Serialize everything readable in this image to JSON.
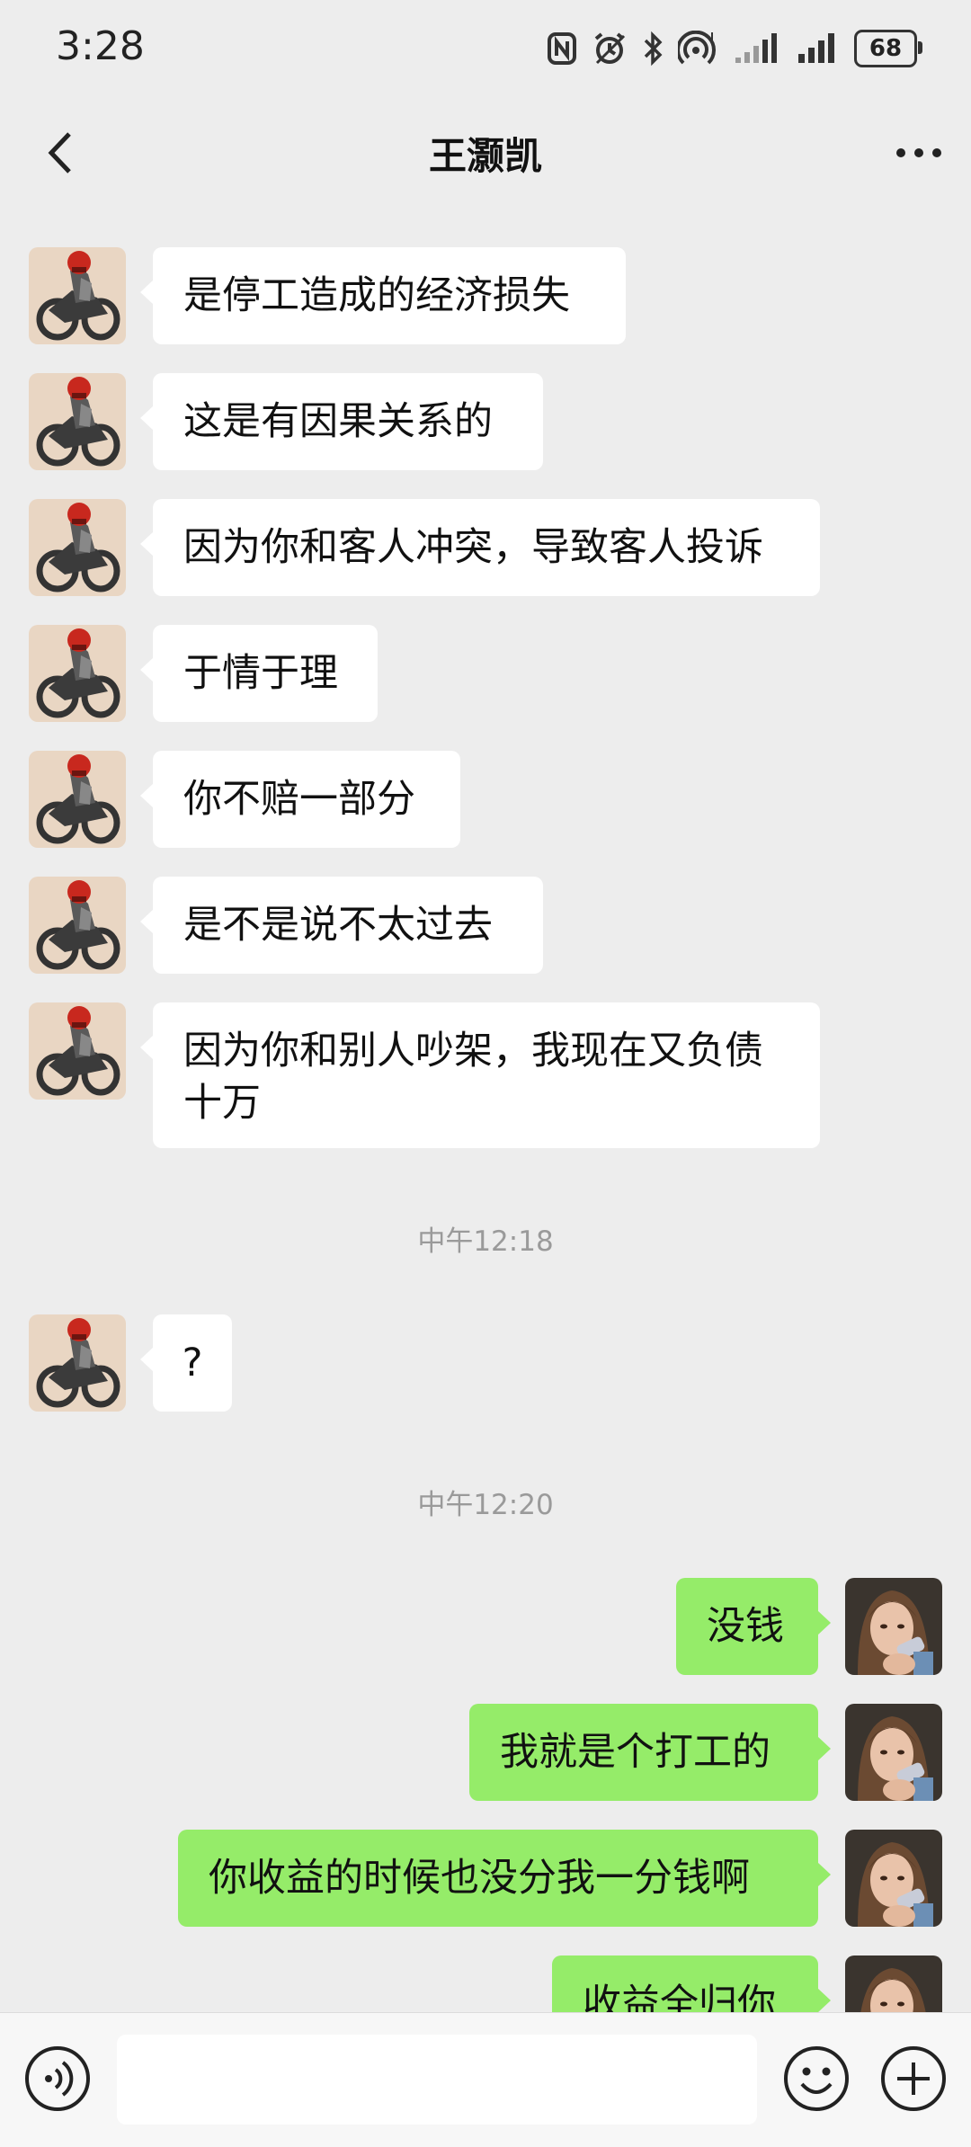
{
  "status_bar": {
    "time": "3:28",
    "battery": "68"
  },
  "header": {
    "title": "王灏凯"
  },
  "messages": [
    {
      "text": "是停工造成的经济损失"
    },
    {
      "text": "这是有因果关系的"
    },
    {
      "text": "因为你和客人冲突，导致客人投诉"
    },
    {
      "text": "于情于理"
    },
    {
      "text": "你不赔一部分"
    },
    {
      "text": "是不是说不太过去"
    },
    {
      "text": "因为你和别人吵架，我现在又负债十万"
    },
    {
      "timestamp": "中午12:18"
    },
    {
      "text": "?"
    },
    {
      "timestamp": "中午12:20"
    },
    {
      "text": "没钱"
    },
    {
      "text": "我就是个打工的"
    },
    {
      "text": "你收益的时候也没分我一分钱啊"
    },
    {
      "text": "收益全归你"
    }
  ],
  "colors": {
    "incoming_bubble": "#ffffff",
    "outgoing_bubble": "#95ec69",
    "background": "#ededed"
  }
}
